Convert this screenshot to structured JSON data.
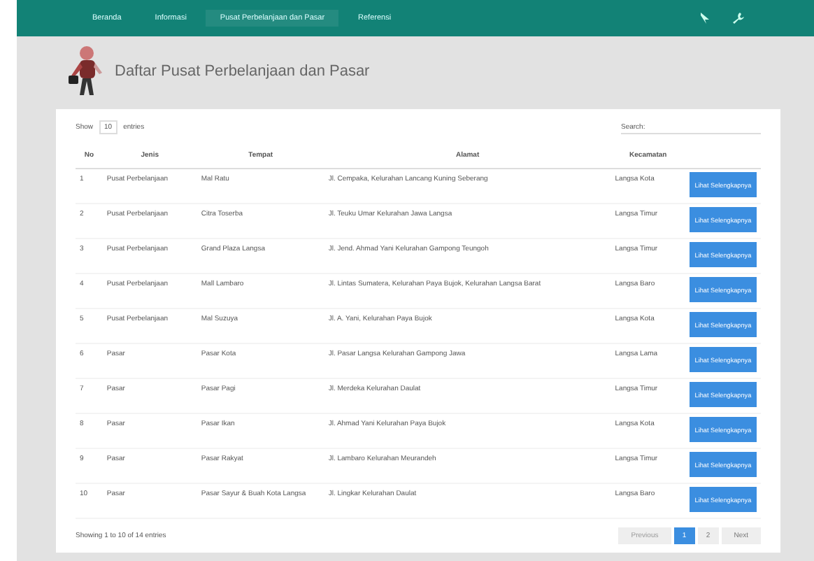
{
  "nav": {
    "items": [
      {
        "label": "Beranda",
        "selected": false
      },
      {
        "label": "Informasi",
        "selected": false
      },
      {
        "label": "Pusat Perbelanjaan dan Pasar",
        "selected": true
      },
      {
        "label": "Referensi",
        "selected": false
      }
    ]
  },
  "page_title": "Daftar Pusat Perbelanjaan dan Pasar",
  "length": {
    "before": "Show",
    "value": "10",
    "after": "entries"
  },
  "search": {
    "placeholder": "Search:"
  },
  "table": {
    "columns": [
      "No",
      "Jenis",
      "Tempat",
      "Alamat",
      "Kecamatan",
      ""
    ],
    "rows": [
      {
        "no": "1",
        "jenis": "Pusat Perbelanjaan",
        "tempat": "Mal Ratu",
        "alamat": "Jl. Cempaka, Kelurahan Lancang Kuning Seberang",
        "kecamatan": "Langsa Kota",
        "action": "Lihat Selengkapnya"
      },
      {
        "no": "2",
        "jenis": "Pusat Perbelanjaan",
        "tempat": "Citra Toserba",
        "alamat": "Jl. Teuku Umar Kelurahan Jawa Langsa",
        "kecamatan": "Langsa Timur",
        "action": "Lihat Selengkapnya"
      },
      {
        "no": "3",
        "jenis": "Pusat Perbelanjaan",
        "tempat": "Grand Plaza Langsa",
        "alamat": "Jl. Jend. Ahmad Yani Kelurahan Gampong Teungoh",
        "kecamatan": "Langsa Timur",
        "action": "Lihat Selengkapnya"
      },
      {
        "no": "4",
        "jenis": "Pusat Perbelanjaan",
        "tempat": "Mall Lambaro",
        "alamat": "Jl. Lintas Sumatera, Kelurahan Paya Bujok, Kelurahan Langsa Barat",
        "kecamatan": "Langsa Baro",
        "action": "Lihat Selengkapnya"
      },
      {
        "no": "5",
        "jenis": "Pusat Perbelanjaan",
        "tempat": "Mal Suzuya",
        "alamat": "Jl. A. Yani, Kelurahan Paya Bujok",
        "kecamatan": "Langsa Kota",
        "action": "Lihat Selengkapnya"
      },
      {
        "no": "6",
        "jenis": "Pasar",
        "tempat": "Pasar Kota",
        "alamat": "Jl. Pasar Langsa Kelurahan Gampong Jawa",
        "kecamatan": "Langsa Lama",
        "action": "Lihat Selengkapnya"
      },
      {
        "no": "7",
        "jenis": "Pasar",
        "tempat": "Pasar Pagi",
        "alamat": "Jl. Merdeka Kelurahan Daulat",
        "kecamatan": "Langsa Timur",
        "action": "Lihat Selengkapnya"
      },
      {
        "no": "8",
        "jenis": "Pasar",
        "tempat": "Pasar Ikan",
        "alamat": "Jl. Ahmad Yani Kelurahan Paya Bujok",
        "kecamatan": "Langsa Kota",
        "action": "Lihat Selengkapnya"
      },
      {
        "no": "9",
        "jenis": "Pasar",
        "tempat": "Pasar Rakyat",
        "alamat": "Jl. Lambaro Kelurahan Meurandeh",
        "kecamatan": "Langsa Timur",
        "action": "Lihat Selengkapnya"
      },
      {
        "no": "10",
        "jenis": "Pasar",
        "tempat": "Pasar Sayur & Buah Kota Langsa",
        "alamat": "Jl. Lingkar Kelurahan Daulat",
        "kecamatan": "Langsa Baro",
        "action": "Lihat Selengkapnya"
      }
    ]
  },
  "info": "Showing 1 to 10 of 14 entries",
  "pagination": [
    {
      "label": "Previous",
      "kind": "nav",
      "selected": false,
      "disabled": true
    },
    {
      "label": "1",
      "kind": "page",
      "selected": true,
      "disabled": false
    },
    {
      "label": "2",
      "kind": "page",
      "selected": false,
      "disabled": false
    },
    {
      "label": "Next",
      "kind": "nav",
      "selected": false,
      "disabled": false
    }
  ]
}
